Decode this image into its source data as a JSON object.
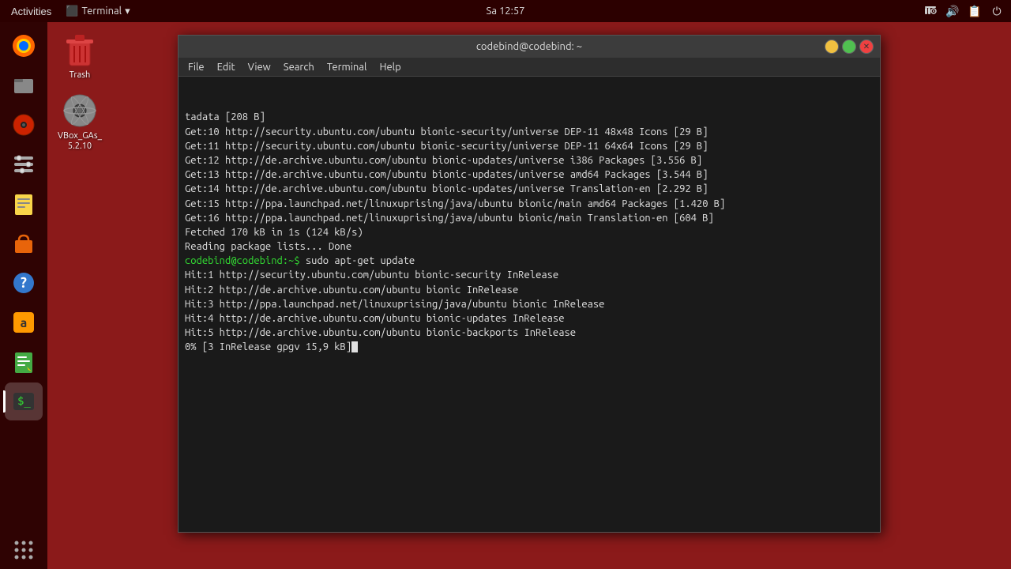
{
  "topbar": {
    "activities": "Activities",
    "terminal_menu": "Terminal",
    "terminal_arrow": "▾",
    "datetime": "Sa 12:57"
  },
  "desktop_icons": [
    {
      "id": "trash",
      "label": "Trash",
      "type": "trash"
    },
    {
      "id": "vboxgas",
      "label": "VBox_GAs_\n5.2.10",
      "type": "disk"
    }
  ],
  "taskbar_items": [
    {
      "id": "firefox",
      "type": "firefox",
      "active": false
    },
    {
      "id": "files",
      "type": "files",
      "active": false
    },
    {
      "id": "cdrom",
      "type": "cdrom",
      "active": false
    },
    {
      "id": "settings",
      "type": "settings",
      "active": false
    },
    {
      "id": "notes",
      "type": "notes",
      "active": false
    },
    {
      "id": "store",
      "type": "store",
      "active": false
    },
    {
      "id": "help",
      "type": "help",
      "active": false
    },
    {
      "id": "amazon",
      "type": "amazon",
      "active": false
    },
    {
      "id": "pad",
      "type": "pad",
      "active": false
    },
    {
      "id": "terminal",
      "type": "terminal",
      "active": true
    },
    {
      "id": "apps",
      "type": "apps",
      "active": false
    }
  ],
  "terminal": {
    "title": "codebind@codebind: ~",
    "menu": [
      "File",
      "Edit",
      "View",
      "Search",
      "Terminal",
      "Help"
    ],
    "lines": [
      "tadata [208 B]",
      "Get:10 http://security.ubuntu.com/ubuntu bionic-security/universe DEP-11 48x48 Icons [29 B]",
      "Get:11 http://security.ubuntu.com/ubuntu bionic-security/universe DEP-11 64x64 Icons [29 B]",
      "Get:12 http://de.archive.ubuntu.com/ubuntu bionic-updates/universe i386 Packages [3.556 B]",
      "Get:13 http://de.archive.ubuntu.com/ubuntu bionic-updates/universe amd64 Packages [3.544 B]",
      "Get:14 http://de.archive.ubuntu.com/ubuntu bionic-updates/universe Translation-en [2.292 B]",
      "Get:15 http://ppa.launchpad.net/linuxuprising/java/ubuntu bionic/main amd64 Packages [1.420 B]",
      "Get:16 http://ppa.launchpad.net/linuxuprising/java/ubuntu bionic/main Translation-en [604 B]",
      "Fetched 170 kB in 1s (124 kB/s)",
      "Reading package lists... Done"
    ],
    "prompt_user": "codebind@codebind",
    "prompt_path": ":~$",
    "command": " sudo apt-get update",
    "output_lines": [
      "Hit:1 http://security.ubuntu.com/ubuntu bionic-security InRelease",
      "Hit:2 http://de.archive.ubuntu.com/ubuntu bionic InRelease",
      "Hit:3 http://ppa.launchpad.net/linuxuprising/java/ubuntu bionic InRelease",
      "Hit:4 http://de.archive.ubuntu.com/ubuntu bionic-updates InRelease",
      "Hit:5 http://de.archive.ubuntu.com/ubuntu bionic-backports InRelease"
    ],
    "current_line": "0% [3 InRelease gpgv 15,9 kB]"
  }
}
